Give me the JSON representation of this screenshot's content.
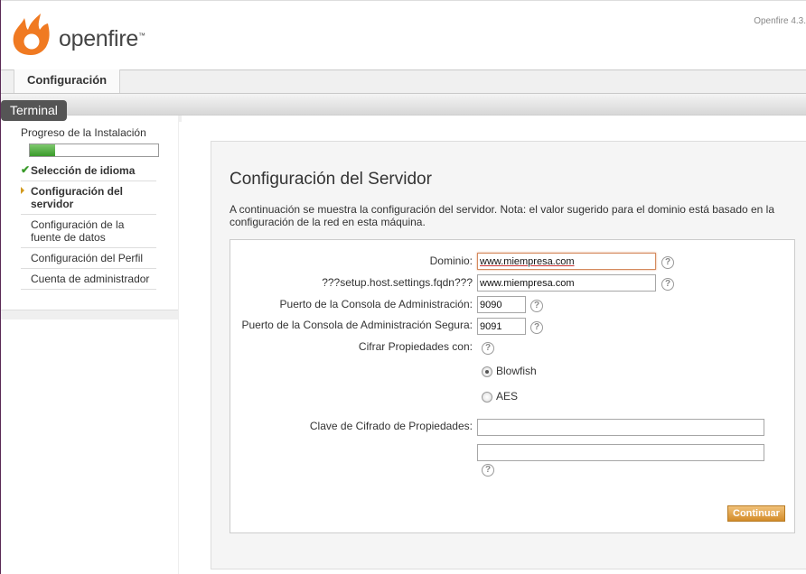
{
  "header": {
    "brand": "openfire",
    "trademark": "™",
    "version": "Openfire 4.3."
  },
  "tabs": {
    "active": "Configuración"
  },
  "overlay": {
    "terminal": "Terminal"
  },
  "sidebar": {
    "progress_title": "Progreso de la Instalación",
    "progress_fraction": 0.2,
    "steps": [
      {
        "label": "Selección de idioma",
        "state": "done"
      },
      {
        "label": "Configuración del servidor",
        "state": "active"
      },
      {
        "label": "Configuración de la fuente de datos",
        "state": "pending"
      },
      {
        "label": "Configuración del Perfil",
        "state": "pending"
      },
      {
        "label": "Cuenta de administrador",
        "state": "pending"
      }
    ]
  },
  "main": {
    "title": "Configuración del Servidor",
    "intro": "A continuación se muestra la configuración del servidor. Nota: el valor sugerido para el dominio está basado en la configuración de la red en esta máquina.",
    "form": {
      "domain_label": "Dominio:",
      "domain_value": "www.miempresa.com",
      "fqdn_label": "???setup.host.settings.fqdn???",
      "fqdn_value": "www.miempresa.com",
      "admin_port_label": "Puerto de la Consola de Administración:",
      "admin_port_value": "9090",
      "secure_port_label": "Puerto de la Consola de Administración Segura:",
      "secure_port_value": "9091",
      "encrypt_label": "Cifrar Propiedades con:",
      "option_blowfish": "Blowfish",
      "option_aes": "AES",
      "selected_option": "Blowfish",
      "key_label": "Clave de Cifrado de Propiedades:",
      "key_value": "",
      "key_confirm_value": "",
      "help_glyph": "?",
      "continue_label": "Continuar"
    }
  },
  "colors": {
    "accent": "#d38c2a",
    "progress": "#3a9a2a",
    "logo_orange": "#f07a22"
  }
}
